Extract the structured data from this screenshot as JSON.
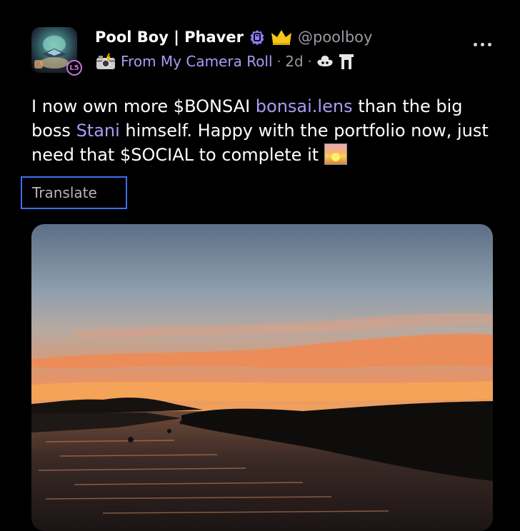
{
  "author": {
    "display_name": "Pool Boy | Phaver",
    "handle": "@poolboy",
    "level_badge": "L5",
    "icons": [
      "verified-badge-icon",
      "crown-icon"
    ]
  },
  "meta": {
    "community_icon": "camera-flash-icon",
    "community": "From My Camera Roll",
    "separator": "·",
    "time_ago": "2d",
    "app_icons": [
      "lens-icon",
      "gateway-icon"
    ]
  },
  "post": {
    "text_part1": "I now own more $BONSAI ",
    "mention1": "bonsai.lens",
    "text_part2": " than the big boss ",
    "mention2": "Stani",
    "text_part3": " himself. Happy with the portfolio now, just need that $SOCIAL to complete it ",
    "emoji": "sunrise-emoji"
  },
  "actions": {
    "translate_label": "Translate",
    "more_icon": "more-options-icon"
  },
  "image": {
    "subject": "sunset-over-lake-photo"
  },
  "colors": {
    "background": "#000000",
    "accent": "#a99cf4",
    "muted": "#9a9aa2",
    "translate_border": "#3d6ff0",
    "crown": "#f5c518"
  }
}
